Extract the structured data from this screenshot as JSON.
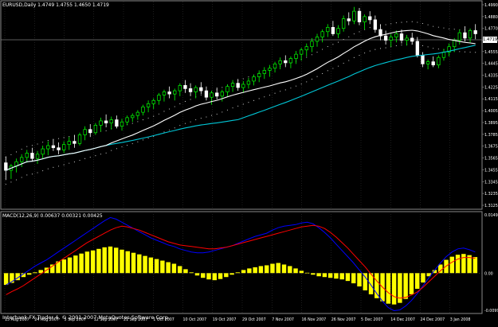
{
  "main_chart": {
    "header": "EURUSD,Daily  1.4749 1.4755 1.4650 1.4719",
    "current_price_label": "1.4719",
    "price_axis_labels": [
      "1.4990",
      "1.4880",
      "1.4770",
      "1.4660",
      "1.4555",
      "1.4445",
      "1.4335",
      "1.4225",
      "1.4115",
      "1.4005",
      "1.3895",
      "1.3785",
      "1.3675",
      "1.3565",
      "1.3455",
      "1.3345",
      "1.3235",
      "1.3125"
    ],
    "watermark": "Interbank FX Trader 4, © 2001-2007 MetaQuotes Software Corp."
  },
  "indicator": {
    "header": "MACD(12,26,9) 0.00637 0.00321 0.00425",
    "axis_labels": [
      "0.0149",
      "0.00",
      "-0.0099"
    ]
  },
  "time_axis": {
    "labels": [
      "15 Aug 2007",
      "24 Aug 2007",
      "5 Sep 2007",
      "12 Sep 2007",
      "21 Sep 2007",
      "1 Oct 2007",
      "10 Oct 2007",
      "19 Oct 2007",
      "29 Oct 2007",
      "7 Nov 2007",
      "16 Nov 2007",
      "26 Nov 2007",
      "5 Dec 2007",
      "14 Dec 2007",
      "24 Dec 2007",
      "3 Jan 2008"
    ]
  },
  "colors": {
    "background": "#000000",
    "bull_candle": "#00ff00",
    "bear_candle": "#ffffff",
    "ma_fast": "#ffffff",
    "ma_slow": "#00c8d8",
    "macd_hist": "#ffff00",
    "macd_line": "#0000ff",
    "signal_line": "#ff0000"
  },
  "chart_data": [
    {
      "type": "line",
      "title": "EURUSD,Daily",
      "note_type": "candlestick",
      "y_range": [
        1.3125,
        1.499
      ],
      "ohlc": [
        [
          1.352,
          1.358,
          1.336,
          1.345
        ],
        [
          1.345,
          1.351,
          1.337,
          1.349
        ],
        [
          1.349,
          1.356,
          1.343,
          1.353
        ],
        [
          1.353,
          1.36,
          1.348,
          1.357
        ],
        [
          1.357,
          1.364,
          1.352,
          1.361
        ],
        [
          1.361,
          1.366,
          1.353,
          1.356
        ],
        [
          1.356,
          1.363,
          1.351,
          1.36
        ],
        [
          1.36,
          1.368,
          1.356,
          1.365
        ],
        [
          1.365,
          1.372,
          1.359,
          1.368
        ],
        [
          1.368,
          1.374,
          1.363,
          1.366
        ],
        [
          1.366,
          1.371,
          1.36,
          1.364
        ],
        [
          1.364,
          1.372,
          1.361,
          1.369
        ],
        [
          1.369,
          1.376,
          1.364,
          1.372
        ],
        [
          1.372,
          1.378,
          1.366,
          1.37
        ],
        [
          1.37,
          1.38,
          1.368,
          1.378
        ],
        [
          1.378,
          1.386,
          1.373,
          1.383
        ],
        [
          1.383,
          1.388,
          1.376,
          1.38
        ],
        [
          1.38,
          1.389,
          1.378,
          1.387
        ],
        [
          1.387,
          1.394,
          1.381,
          1.391
        ],
        [
          1.391,
          1.397,
          1.385,
          1.389
        ],
        [
          1.389,
          1.395,
          1.383,
          1.392
        ],
        [
          1.392,
          1.396,
          1.384,
          1.386
        ],
        [
          1.386,
          1.393,
          1.382,
          1.39
        ],
        [
          1.39,
          1.396,
          1.387,
          1.394
        ],
        [
          1.394,
          1.398,
          1.39,
          1.396
        ],
        [
          1.396,
          1.401,
          1.392,
          1.399
        ],
        [
          1.399,
          1.406,
          1.396,
          1.404
        ],
        [
          1.404,
          1.41,
          1.399,
          1.407
        ],
        [
          1.407,
          1.412,
          1.402,
          1.41
        ],
        [
          1.41,
          1.417,
          1.406,
          1.415
        ],
        [
          1.415,
          1.42,
          1.409,
          1.418
        ],
        [
          1.418,
          1.423,
          1.412,
          1.416
        ],
        [
          1.416,
          1.421,
          1.41,
          1.419
        ],
        [
          1.419,
          1.426,
          1.414,
          1.424
        ],
        [
          1.424,
          1.429,
          1.417,
          1.421
        ],
        [
          1.421,
          1.426,
          1.414,
          1.418
        ],
        [
          1.418,
          1.424,
          1.412,
          1.422
        ],
        [
          1.422,
          1.427,
          1.416,
          1.419
        ],
        [
          1.419,
          1.423,
          1.41,
          1.413
        ],
        [
          1.413,
          1.419,
          1.406,
          1.417
        ],
        [
          1.417,
          1.422,
          1.411,
          1.414
        ],
        [
          1.414,
          1.42,
          1.409,
          1.418
        ],
        [
          1.418,
          1.425,
          1.414,
          1.423
        ],
        [
          1.423,
          1.429,
          1.418,
          1.426
        ],
        [
          1.426,
          1.43,
          1.419,
          1.422
        ],
        [
          1.422,
          1.428,
          1.417,
          1.425
        ],
        [
          1.425,
          1.431,
          1.421,
          1.428
        ],
        [
          1.428,
          1.434,
          1.424,
          1.432
        ],
        [
          1.432,
          1.438,
          1.427,
          1.435
        ],
        [
          1.435,
          1.441,
          1.43,
          1.438
        ],
        [
          1.438,
          1.443,
          1.432,
          1.44
        ],
        [
          1.44,
          1.446,
          1.436,
          1.444
        ],
        [
          1.444,
          1.45,
          1.439,
          1.447
        ],
        [
          1.447,
          1.452,
          1.441,
          1.445
        ],
        [
          1.445,
          1.451,
          1.44,
          1.449
        ],
        [
          1.449,
          1.456,
          1.444,
          1.453
        ],
        [
          1.453,
          1.459,
          1.447,
          1.457
        ],
        [
          1.457,
          1.463,
          1.451,
          1.46
        ],
        [
          1.46,
          1.468,
          1.455,
          1.465
        ],
        [
          1.465,
          1.472,
          1.46,
          1.469
        ],
        [
          1.469,
          1.476,
          1.464,
          1.474
        ],
        [
          1.474,
          1.481,
          1.469,
          1.478
        ],
        [
          1.478,
          1.484,
          1.47,
          1.472
        ],
        [
          1.472,
          1.48,
          1.468,
          1.477
        ],
        [
          1.477,
          1.489,
          1.474,
          1.486
        ],
        [
          1.486,
          1.492,
          1.48,
          1.484
        ],
        [
          1.484,
          1.497,
          1.481,
          1.493
        ],
        [
          1.493,
          1.496,
          1.48,
          1.483
        ],
        [
          1.483,
          1.49,
          1.476,
          1.488
        ],
        [
          1.488,
          1.493,
          1.481,
          1.485
        ],
        [
          1.485,
          1.489,
          1.473,
          1.476
        ],
        [
          1.476,
          1.481,
          1.466,
          1.47
        ],
        [
          1.47,
          1.475,
          1.462,
          1.466
        ],
        [
          1.466,
          1.472,
          1.46,
          1.469
        ],
        [
          1.469,
          1.475,
          1.464,
          1.472
        ],
        [
          1.472,
          1.476,
          1.463,
          1.466
        ],
        [
          1.466,
          1.471,
          1.461,
          1.468
        ],
        [
          1.468,
          1.473,
          1.462,
          1.465
        ],
        [
          1.465,
          1.469,
          1.45,
          1.452
        ],
        [
          1.452,
          1.455,
          1.441,
          1.444
        ],
        [
          1.444,
          1.448,
          1.439,
          1.446
        ],
        [
          1.446,
          1.451,
          1.441,
          1.443
        ],
        [
          1.443,
          1.452,
          1.44,
          1.45
        ],
        [
          1.45,
          1.458,
          1.447,
          1.455
        ],
        [
          1.455,
          1.463,
          1.451,
          1.46
        ],
        [
          1.46,
          1.468,
          1.455,
          1.466
        ],
        [
          1.466,
          1.476,
          1.462,
          1.473
        ],
        [
          1.473,
          1.479,
          1.465,
          1.468
        ],
        [
          1.468,
          1.477,
          1.464,
          1.475
        ],
        [
          1.475,
          1.481,
          1.467,
          1.472
        ]
      ]
    },
    {
      "type": "bar",
      "title": "MACD(12,26,9)",
      "y_range": [
        -0.0099,
        0.0149
      ],
      "histogram": [
        -0.003,
        -0.0025,
        -0.0018,
        -0.001,
        -0.0004,
        0.0002,
        0.0008,
        0.0014,
        0.0022,
        0.003,
        0.0035,
        0.004,
        0.0045,
        0.005,
        0.0055,
        0.0058,
        0.0062,
        0.0066,
        0.0068,
        0.0065,
        0.006,
        0.0056,
        0.0052,
        0.0048,
        0.0044,
        0.004,
        0.0036,
        0.0032,
        0.0028,
        0.0024,
        0.0018,
        0.001,
        0.0002,
        -0.0006,
        -0.0012,
        -0.0016,
        -0.0018,
        -0.0015,
        -0.001,
        -0.0004,
        0.0002,
        0.0008,
        0.0012,
        0.0015,
        0.0018,
        0.002,
        0.0024,
        0.0026,
        0.0022,
        0.0018,
        0.0012,
        0.0006,
        0.0001,
        -0.0004,
        -0.0008,
        -0.001,
        -0.0012,
        -0.0014,
        -0.0016,
        -0.002,
        -0.0026,
        -0.0034,
        -0.0044,
        -0.0054,
        -0.0064,
        -0.0072,
        -0.0078,
        -0.008,
        -0.0076,
        -0.0066,
        -0.0054,
        -0.004,
        -0.0024,
        -0.0008,
        0.0008,
        0.0022,
        0.0034,
        0.0042,
        0.0047,
        0.0049,
        0.0046,
        0.0041
      ],
      "macd": [
        -0.003,
        -0.0022,
        -0.0012,
        -0.0002,
        0.0008,
        0.0018,
        0.0026,
        0.0034,
        0.0044,
        0.0054,
        0.0064,
        0.0074,
        0.0084,
        0.0094,
        0.0104,
        0.0114,
        0.0124,
        0.0134,
        0.0142,
        0.0138,
        0.013,
        0.0122,
        0.0114,
        0.0106,
        0.0098,
        0.009,
        0.0084,
        0.0078,
        0.0072,
        0.0068,
        0.0062,
        0.0058,
        0.0054,
        0.0052,
        0.0052,
        0.0054,
        0.0058,
        0.0062,
        0.0066,
        0.007,
        0.0076,
        0.0082,
        0.0088,
        0.0094,
        0.0098,
        0.0102,
        0.011,
        0.0116,
        0.012,
        0.0122,
        0.0124,
        0.0128,
        0.013,
        0.0126,
        0.0116,
        0.0104,
        0.009,
        0.0074,
        0.0058,
        0.0042,
        0.0026,
        0.0008,
        -0.001,
        -0.003,
        -0.0052,
        -0.0072,
        -0.0088,
        -0.0096,
        -0.0094,
        -0.0084,
        -0.007,
        -0.0052,
        -0.0032,
        -0.0012,
        0.0008,
        0.0026,
        0.0042,
        0.0054,
        0.0062,
        0.0064,
        0.006,
        0.0054
      ],
      "signal": [
        -0.0055,
        -0.0047,
        -0.004,
        -0.0032,
        -0.0022,
        -0.0012,
        -0.0002,
        0.0008,
        0.0018,
        0.0028,
        0.0038,
        0.0048,
        0.0058,
        0.0068,
        0.0078,
        0.0086,
        0.0094,
        0.0102,
        0.011,
        0.0116,
        0.012,
        0.0118,
        0.0114,
        0.011,
        0.0104,
        0.0098,
        0.0092,
        0.0086,
        0.008,
        0.0076,
        0.0072,
        0.007,
        0.0068,
        0.0066,
        0.0064,
        0.0062,
        0.0062,
        0.0064,
        0.0066,
        0.007,
        0.0074,
        0.0078,
        0.0082,
        0.0086,
        0.009,
        0.0094,
        0.0098,
        0.0102,
        0.0106,
        0.011,
        0.0114,
        0.0118,
        0.012,
        0.0122,
        0.012,
        0.0114,
        0.0104,
        0.0092,
        0.0078,
        0.0064,
        0.0048,
        0.0032,
        0.0016,
        -0.0002,
        -0.002,
        -0.0036,
        -0.005,
        -0.006,
        -0.0064,
        -0.0062,
        -0.0056,
        -0.0048,
        -0.0036,
        -0.0022,
        -0.0008,
        0.0006,
        0.0018,
        0.0028,
        0.0036,
        0.004,
        0.004,
        0.0038
      ]
    }
  ]
}
